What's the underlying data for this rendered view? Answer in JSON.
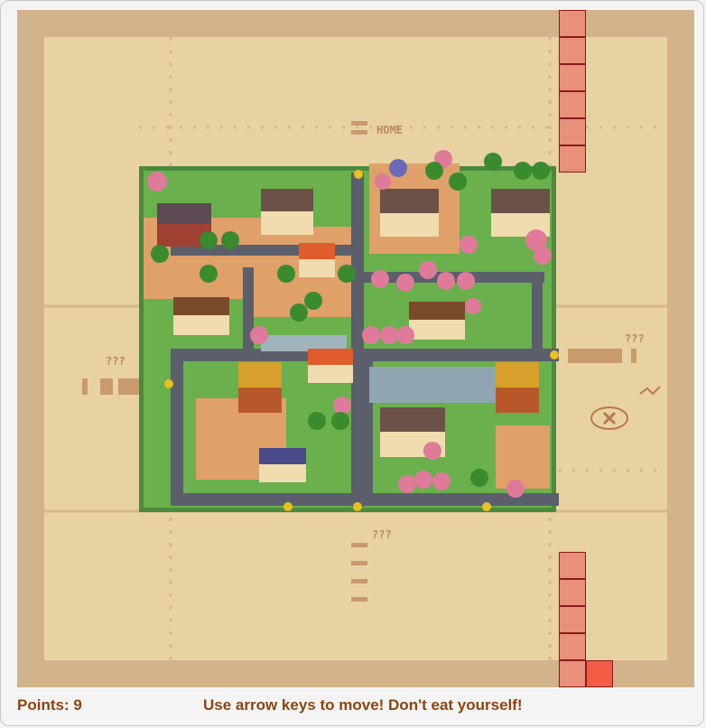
{
  "hud": {
    "points_label": "Points: 9",
    "instruction": "Use arrow keys to move! Don't eat yourself!"
  },
  "map_labels": {
    "home": "HOME",
    "unknown_east": "???",
    "unknown_west": "???",
    "unknown_south": "???"
  },
  "game": {
    "grid_size": 25,
    "head_direction": "right",
    "snake_cells": [
      [
        20,
        0
      ],
      [
        20,
        1
      ],
      [
        20,
        2
      ],
      [
        20,
        3
      ],
      [
        20,
        4
      ],
      [
        20,
        5
      ],
      [
        20,
        20
      ],
      [
        20,
        21
      ],
      [
        20,
        22
      ],
      [
        20,
        23
      ],
      [
        20,
        24
      ],
      [
        21,
        24
      ]
    ]
  },
  "colors": {
    "border": "#d2b48c",
    "field": "#e8d2a2",
    "snake_body": "#e8907a",
    "snake_head": "#f35d45",
    "snake_outline": "#8b1a1a",
    "text": "#8b4513"
  }
}
